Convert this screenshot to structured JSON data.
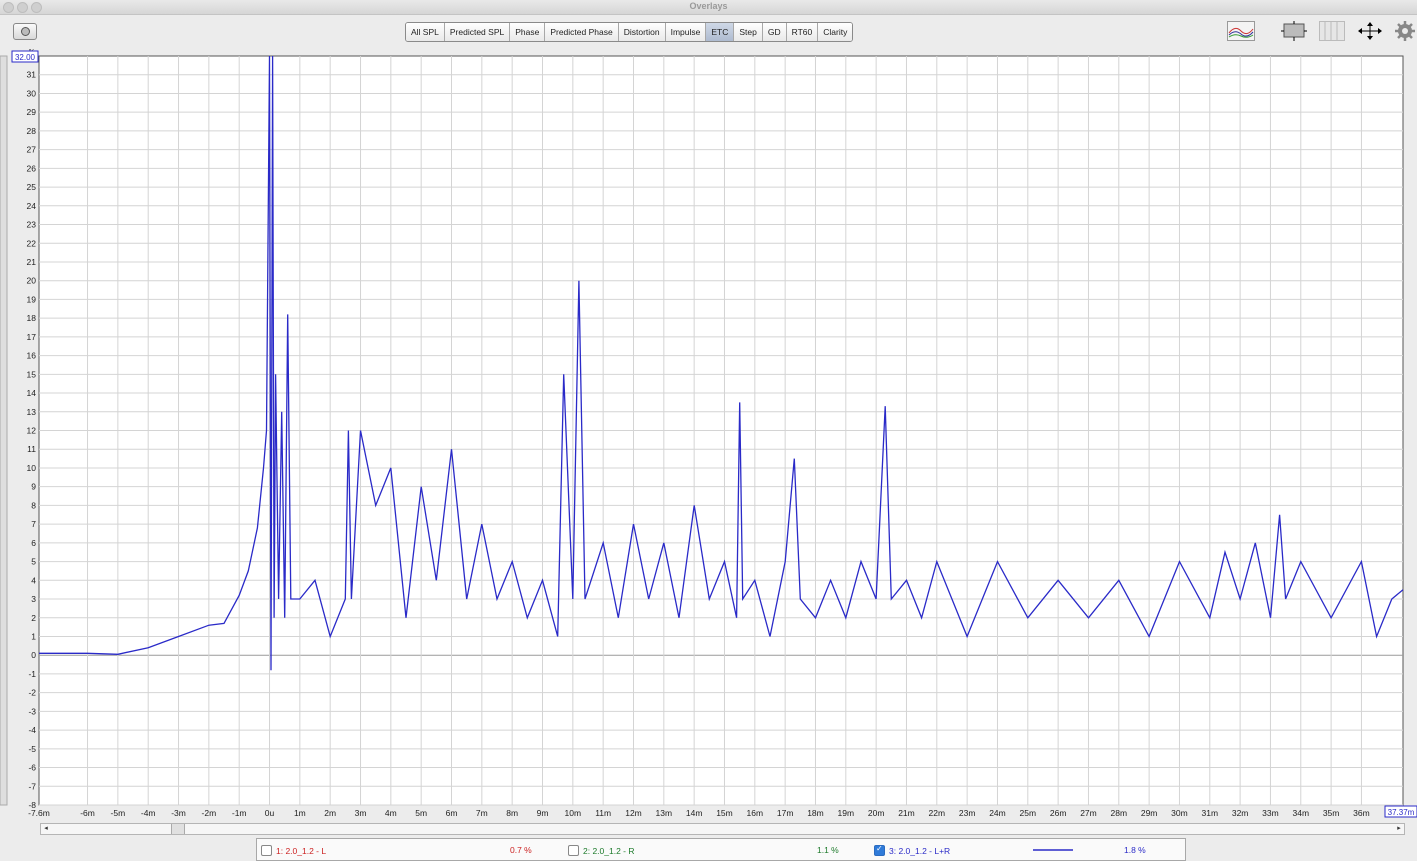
{
  "window": {
    "title": "Overlays"
  },
  "toolbar": {
    "tabs": [
      "All SPL",
      "Predicted SPL",
      "Phase",
      "Predicted Phase",
      "Distortion",
      "Impulse",
      "ETC",
      "Step",
      "GD",
      "RT60",
      "Clarity"
    ],
    "active_tab": "ETC",
    "icons": [
      "camera-icon",
      "traces-icon",
      "fit-view-icon",
      "grid-toggle-icon",
      "zoom-arrows-icon",
      "gear-icon"
    ]
  },
  "chart_data": {
    "type": "line",
    "y_unit": "%",
    "y_top_readout": "32.00",
    "x_right_readout": "37.37m",
    "ylim": [
      -8,
      32
    ],
    "xlim": [
      -7.6,
      37.37
    ],
    "x_ticks": [
      "-7.6m",
      "-6m",
      "-5m",
      "-4m",
      "-3m",
      "-2m",
      "-1m",
      "0u",
      "1m",
      "2m",
      "3m",
      "4m",
      "5m",
      "6m",
      "7m",
      "8m",
      "9m",
      "10m",
      "11m",
      "12m",
      "13m",
      "14m",
      "15m",
      "16m",
      "17m",
      "18m",
      "19m",
      "20m",
      "21m",
      "22m",
      "23m",
      "24m",
      "25m",
      "26m",
      "27m",
      "28m",
      "29m",
      "30m",
      "31m",
      "32m",
      "33m",
      "34m",
      "35m",
      "36m"
    ],
    "y_ticks": [
      31,
      30,
      29,
      28,
      27,
      26,
      25,
      24,
      23,
      22,
      21,
      20,
      19,
      18,
      17,
      16,
      15,
      14,
      13,
      12,
      11,
      10,
      9,
      8,
      7,
      6,
      5,
      4,
      3,
      2,
      1,
      0,
      -1,
      -2,
      -3,
      -4,
      -5,
      -6,
      -7,
      -8
    ],
    "grid": true,
    "series": [
      {
        "name": "3: 2.0_1.2 - L+R",
        "color": "#2a2ac8",
        "points": [
          [
            -7.6,
            0.1
          ],
          [
            -6,
            0.1
          ],
          [
            -5,
            0.05
          ],
          [
            -4,
            0.4
          ],
          [
            -3,
            1.0
          ],
          [
            -2,
            1.6
          ],
          [
            -1.5,
            1.7
          ],
          [
            -1,
            3.2
          ],
          [
            -0.7,
            4.5
          ],
          [
            -0.4,
            6.8
          ],
          [
            -0.2,
            10
          ],
          [
            -0.1,
            12
          ],
          [
            0,
            32
          ],
          [
            0.05,
            -0.8
          ],
          [
            0.1,
            32
          ],
          [
            0.15,
            2
          ],
          [
            0.2,
            15
          ],
          [
            0.3,
            3
          ],
          [
            0.4,
            13
          ],
          [
            0.5,
            2
          ],
          [
            0.6,
            18.2
          ],
          [
            0.7,
            3
          ],
          [
            1,
            3
          ],
          [
            1.5,
            4
          ],
          [
            2,
            1
          ],
          [
            2.5,
            3
          ],
          [
            2.6,
            12
          ],
          [
            2.7,
            3
          ],
          [
            3,
            12
          ],
          [
            3.5,
            8
          ],
          [
            4,
            10
          ],
          [
            4.5,
            2
          ],
          [
            5,
            9
          ],
          [
            5.5,
            4
          ],
          [
            6,
            11
          ],
          [
            6.5,
            3
          ],
          [
            7,
            7
          ],
          [
            7.5,
            3
          ],
          [
            8,
            5
          ],
          [
            8.5,
            2
          ],
          [
            9,
            4
          ],
          [
            9.5,
            1
          ],
          [
            9.7,
            15
          ],
          [
            10,
            3
          ],
          [
            10.2,
            20
          ],
          [
            10.4,
            3
          ],
          [
            11,
            6
          ],
          [
            11.5,
            2
          ],
          [
            12,
            7
          ],
          [
            12.5,
            3
          ],
          [
            13,
            6
          ],
          [
            13.5,
            2
          ],
          [
            14,
            8
          ],
          [
            14.5,
            3
          ],
          [
            15,
            5
          ],
          [
            15.4,
            2
          ],
          [
            15.5,
            13.5
          ],
          [
            15.6,
            3
          ],
          [
            16,
            4
          ],
          [
            16.5,
            1
          ],
          [
            17,
            5
          ],
          [
            17.3,
            10.5
          ],
          [
            17.5,
            3
          ],
          [
            18,
            2
          ],
          [
            18.5,
            4
          ],
          [
            19,
            2
          ],
          [
            19.5,
            5
          ],
          [
            20,
            3
          ],
          [
            20.3,
            13.3
          ],
          [
            20.5,
            3
          ],
          [
            21,
            4
          ],
          [
            21.5,
            2
          ],
          [
            22,
            5
          ],
          [
            23,
            1
          ],
          [
            24,
            5
          ],
          [
            25,
            2
          ],
          [
            26,
            4
          ],
          [
            27,
            2
          ],
          [
            28,
            4
          ],
          [
            29,
            1
          ],
          [
            30,
            5
          ],
          [
            31,
            2
          ],
          [
            31.5,
            5.5
          ],
          [
            32,
            3
          ],
          [
            32.5,
            6
          ],
          [
            33,
            2
          ],
          [
            33.3,
            7.5
          ],
          [
            33.5,
            3
          ],
          [
            34,
            5
          ],
          [
            35,
            2
          ],
          [
            36,
            5
          ],
          [
            36.5,
            1
          ],
          [
            37,
            3
          ],
          [
            37.37,
            3.5
          ]
        ]
      }
    ]
  },
  "scrollbar": {
    "left_arrow": "◂",
    "right_arrow": "▸"
  },
  "legend": [
    {
      "label": "1: 2.0_1.2 - L",
      "value": "0.7 %",
      "checked": false,
      "color": "#cc2222"
    },
    {
      "label": "2: 2.0_1.2 - R",
      "value": "1.1 %",
      "checked": false,
      "color": "#1c7a2a"
    },
    {
      "label": "3: 2.0_1.2 - L+R",
      "value": "1.8 %",
      "checked": true,
      "color": "#2a2ac8"
    }
  ]
}
